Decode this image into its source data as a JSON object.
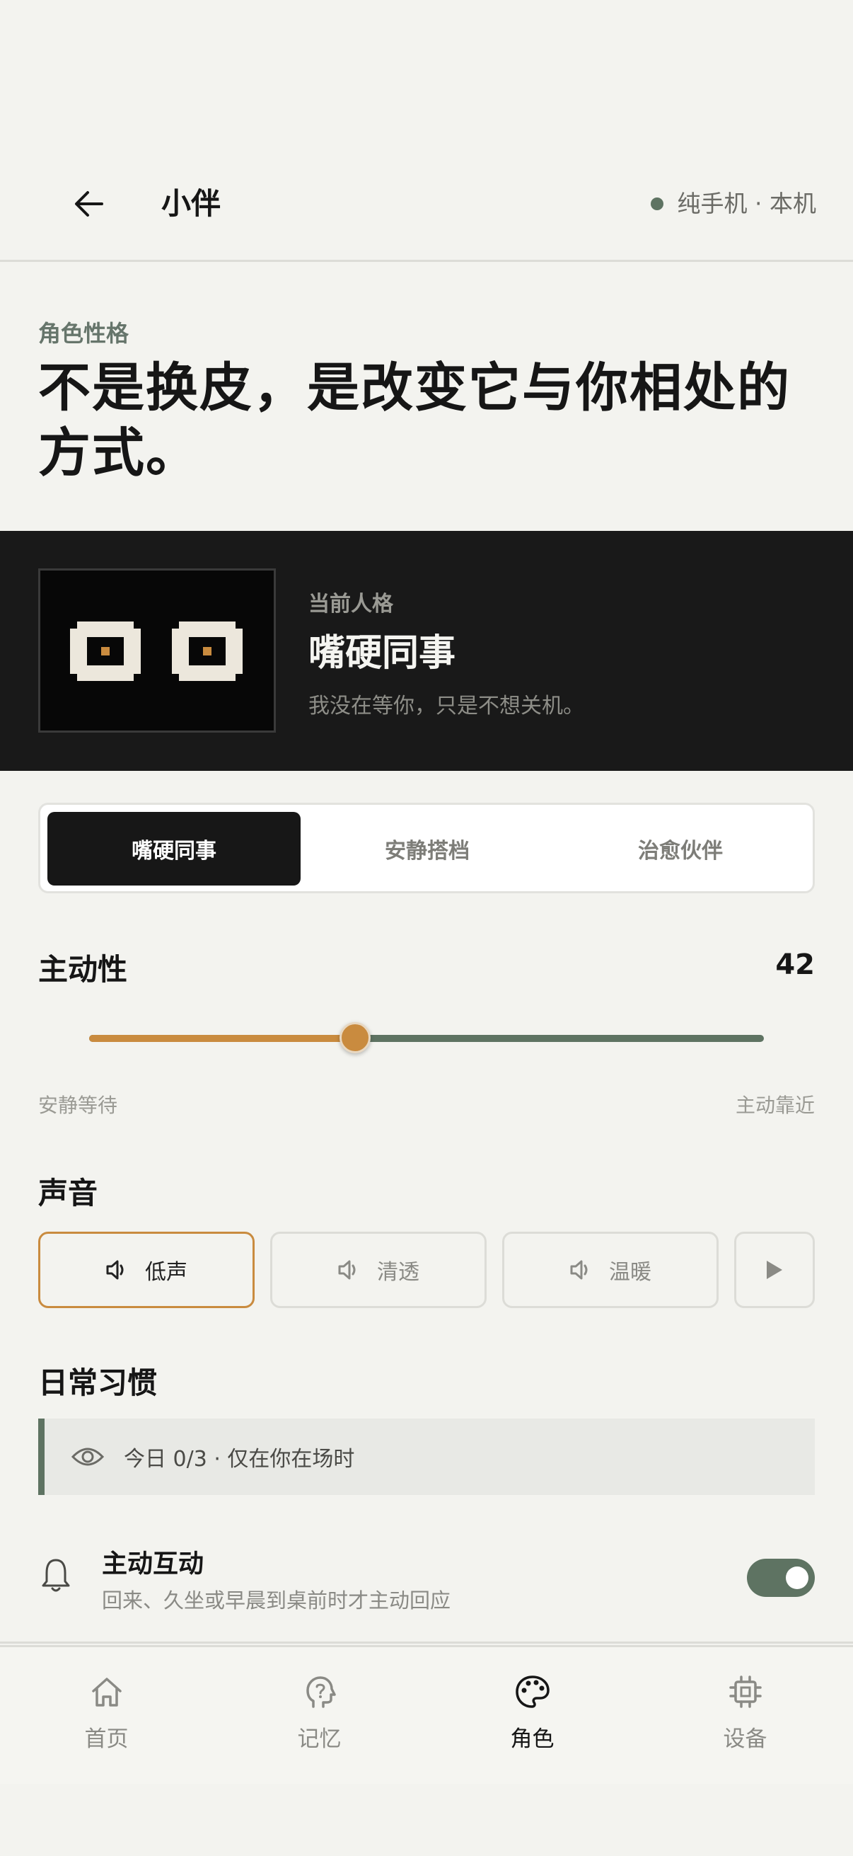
{
  "header": {
    "title": "小伴",
    "device_status": "纯手机 · 本机"
  },
  "intro": {
    "eyebrow": "角色性格",
    "headline": "不是换皮，是改变它与你相处的方式。"
  },
  "current_persona": {
    "label": "当前人格",
    "name": "嘴硬同事",
    "quote": "我没在等你，只是不想关机。"
  },
  "persona_tabs": [
    {
      "label": "嘴硬同事",
      "active": true
    },
    {
      "label": "安静搭档",
      "active": false
    },
    {
      "label": "治愈伙伴",
      "active": false
    }
  ],
  "initiative": {
    "title": "主动性",
    "value": 42,
    "min_label": "安静等待",
    "max_label": "主动靠近"
  },
  "voice": {
    "title": "声音",
    "options": [
      {
        "label": "低声",
        "icon": "speaker-icon",
        "selected": true
      },
      {
        "label": "清透",
        "icon": "speaker-icon",
        "selected": false
      },
      {
        "label": "温暖",
        "icon": "speaker-icon",
        "selected": false
      }
    ],
    "play_icon": "play-icon"
  },
  "habits": {
    "title": "日常习惯",
    "notice": "今日 0/3 · 仅在你在场时",
    "notice_icon": "eye-icon",
    "items": [
      {
        "title": "主动互动",
        "desc": "回来、久坐或早晨到桌前时才主动回应",
        "icon": "bell-icon",
        "enabled": true
      }
    ]
  },
  "nav": [
    {
      "label": "首页",
      "icon": "home-icon",
      "active": false
    },
    {
      "label": "记忆",
      "icon": "memory-icon",
      "active": false
    },
    {
      "label": "角色",
      "icon": "palette-icon",
      "active": true
    },
    {
      "label": "设备",
      "icon": "chip-icon",
      "active": false
    }
  ],
  "colors": {
    "accent": "#c98b3f",
    "primary": "#5e7362",
    "dark": "#191919",
    "background": "#f3f3ef"
  }
}
